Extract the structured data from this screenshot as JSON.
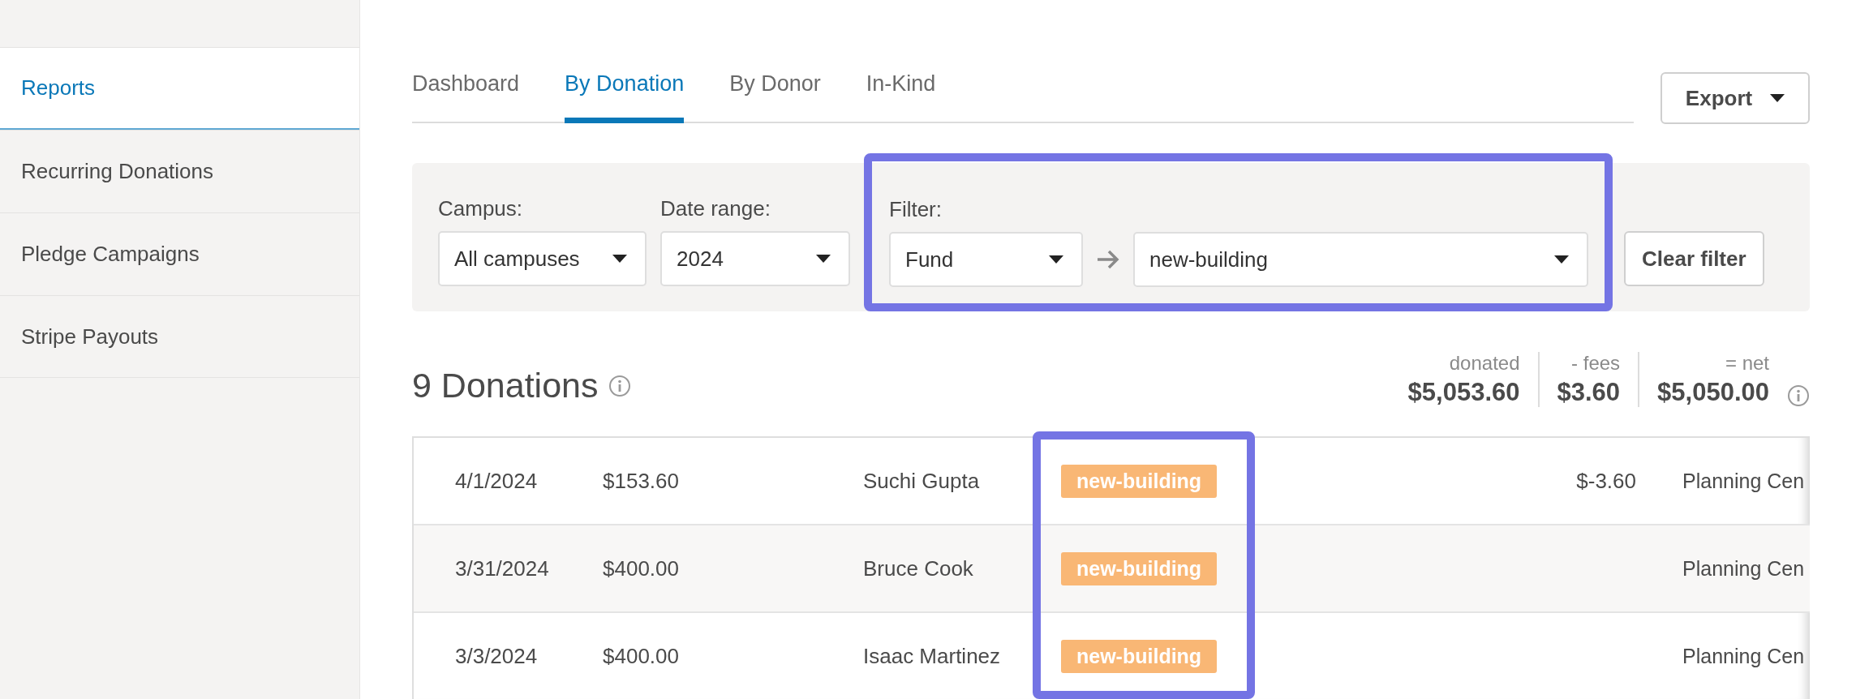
{
  "sidebar": {
    "items": [
      {
        "label": "Reports",
        "selected": true
      },
      {
        "label": "Recurring Donations",
        "selected": false
      },
      {
        "label": "Pledge Campaigns",
        "selected": false
      },
      {
        "label": "Stripe Payouts",
        "selected": false
      }
    ]
  },
  "tabs": [
    {
      "label": "Dashboard",
      "selected": false
    },
    {
      "label": "By Donation",
      "selected": true
    },
    {
      "label": "By Donor",
      "selected": false
    },
    {
      "label": "In-Kind",
      "selected": false
    }
  ],
  "export_button": {
    "label": "Export"
  },
  "filters": {
    "campus": {
      "label": "Campus:",
      "value": "All campuses"
    },
    "date_range": {
      "label": "Date range:",
      "value": "2024"
    },
    "filter": {
      "label": "Filter:",
      "field": "Fund",
      "value": "new-building",
      "highlighted": true
    },
    "clear_button": {
      "label": "Clear filter"
    }
  },
  "summary": {
    "title": "9 Donations",
    "stats": [
      {
        "label": "donated",
        "value": "$5,053.60"
      },
      {
        "label": "- fees",
        "value": "$3.60"
      },
      {
        "label": "= net",
        "value": "$5,050.00"
      }
    ]
  },
  "table": {
    "fund_column_highlighted": true,
    "rows": [
      {
        "date": "4/1/2024",
        "amount": "$153.60",
        "donor": "Suchi Gupta",
        "fund": "new-building",
        "fee": "$-3.60",
        "source": "Planning Cen"
      },
      {
        "date": "3/31/2024",
        "amount": "$400.00",
        "donor": "Bruce Cook",
        "fund": "new-building",
        "source": "Planning Cen"
      },
      {
        "date": "3/3/2024",
        "amount": "$400.00",
        "donor": "Isaac Martinez",
        "fund": "new-building",
        "source": "Planning Cen"
      }
    ]
  }
}
